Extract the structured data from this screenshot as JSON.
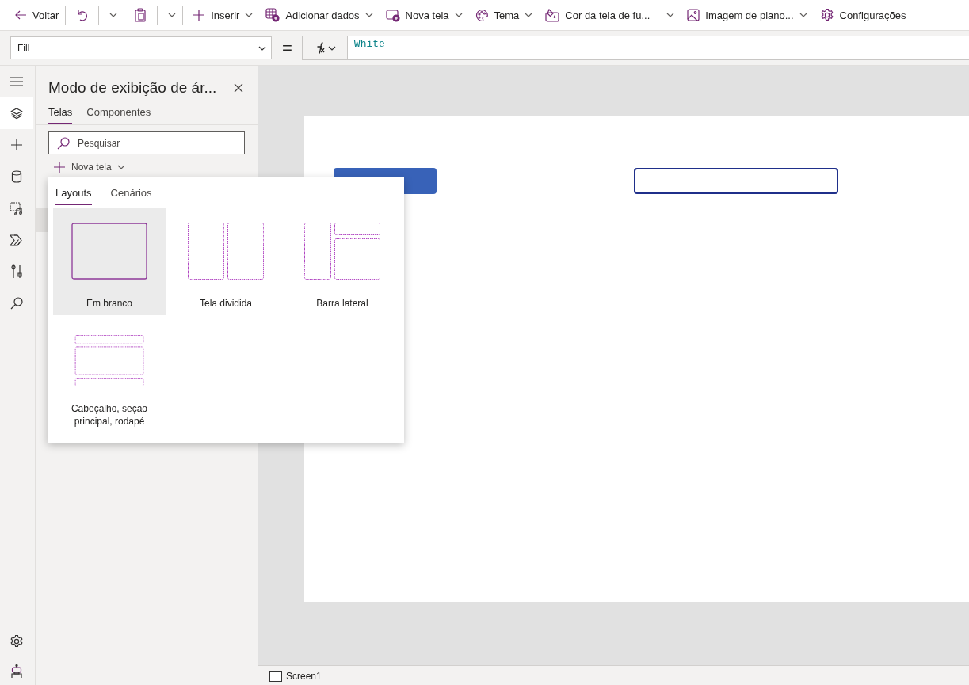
{
  "toolbar": [
    {
      "kind": "back",
      "label": "Voltar",
      "dropdown": false,
      "separator_after": true
    },
    {
      "kind": "undo",
      "dropdown": true,
      "separator_after": true
    },
    {
      "kind": "paste",
      "dropdown": true,
      "separator_after": true
    },
    {
      "kind": "insert",
      "label": "Inserir",
      "dropdown": true,
      "separator_after": false
    },
    {
      "kind": "data",
      "label": "Adicionar dados",
      "dropdown": true,
      "separator_after": false
    },
    {
      "kind": "screen",
      "label": "Nova tela",
      "dropdown": true,
      "separator_after": false
    },
    {
      "kind": "theme",
      "label": "Tema",
      "dropdown": true,
      "separator_after": false
    },
    {
      "kind": "fill",
      "label": "Cor da tela de fu...",
      "dropdown": true,
      "separator_after": false
    },
    {
      "kind": "image",
      "label": "Imagem de plano...",
      "dropdown": true,
      "separator_after": false
    },
    {
      "kind": "settings",
      "label": "Configurações",
      "dropdown": false,
      "separator_after": false
    }
  ],
  "formula_bar": {
    "property": "Fill",
    "operator": "=",
    "formula": "White"
  },
  "rail": {
    "top": [
      {
        "kind": "menu",
        "selected": false
      },
      {
        "kind": "layers",
        "selected": true
      },
      {
        "kind": "insert",
        "selected": false
      },
      {
        "kind": "data",
        "selected": false
      },
      {
        "kind": "media",
        "selected": false
      },
      {
        "kind": "automate",
        "selected": false
      },
      {
        "kind": "tools",
        "selected": false
      },
      {
        "kind": "search",
        "selected": false
      }
    ],
    "bottom": [
      {
        "kind": "settings",
        "selected": false
      },
      {
        "kind": "bot",
        "selected": false
      }
    ]
  },
  "panel": {
    "title": "Modo de exibição de ár...",
    "tabs": [
      {
        "label": "Telas",
        "selected": true
      },
      {
        "label": "Componentes",
        "selected": false
      }
    ],
    "search": {
      "placeholder": "Pesquisar"
    },
    "new_screen": "Nova tela"
  },
  "popup": {
    "tabs": [
      {
        "label": "Layouts",
        "selected": true
      },
      {
        "label": "Cenários",
        "selected": false
      }
    ],
    "layouts": [
      {
        "kind": "blank",
        "label": "Em branco",
        "selected": true
      },
      {
        "kind": "split",
        "label": "Tela dividida",
        "selected": false
      },
      {
        "kind": "sidebar",
        "label": "Barra lateral",
        "selected": false
      },
      {
        "kind": "header_footer",
        "label": "Cabeçalho, seção principal, rodapé",
        "selected": false
      }
    ]
  },
  "status_bar": {
    "screen": "Screen1",
    "checked": false
  }
}
